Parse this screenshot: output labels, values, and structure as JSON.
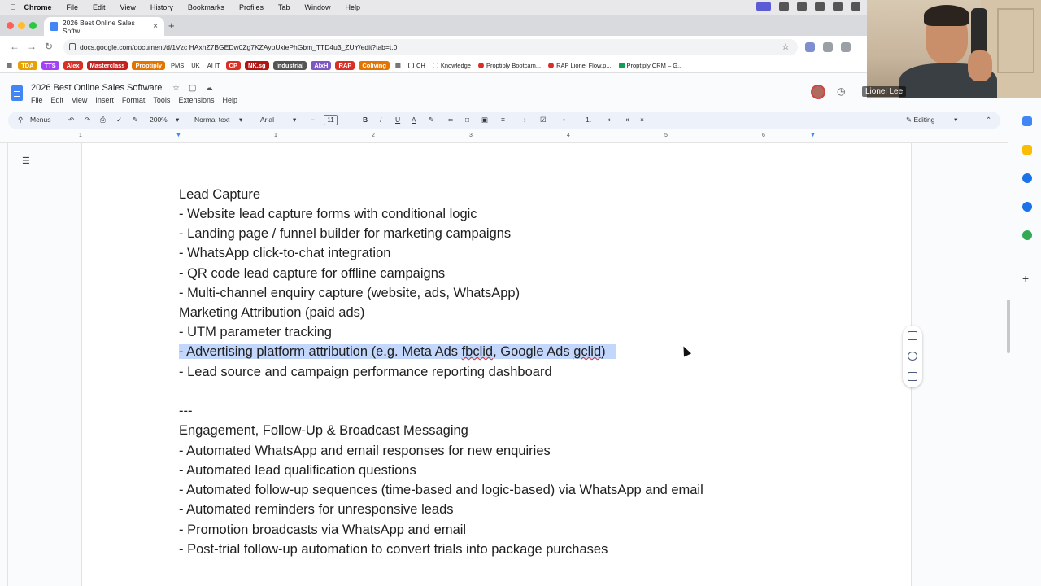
{
  "mac_menu": {
    "app": "Chrome",
    "items": [
      "File",
      "Edit",
      "View",
      "History",
      "Bookmarks",
      "Profiles",
      "Tab",
      "Window",
      "Help"
    ]
  },
  "browser": {
    "tab_title": "2026 Best Online Sales Softw",
    "url": "docs.google.com/document/d/1Vzc HAxhZ7BGEDw0Zg7KZAypUxiePhGbm_TTD4u3_ZUY/edit?tab=t.0",
    "bookmarks": [
      {
        "label": "TDA",
        "color": "#e8a100"
      },
      {
        "label": "TTS",
        "color": "#a142f4"
      },
      {
        "label": "Alex",
        "color": "#d93025"
      },
      {
        "label": "Masterclass",
        "color": "#c5221f"
      },
      {
        "label": "Proptiply",
        "color": "#e37400"
      },
      {
        "label": "PMS",
        "color": ""
      },
      {
        "label": "UK",
        "color": ""
      },
      {
        "label": "AI IT",
        "color": ""
      },
      {
        "label": "CP",
        "color": "#d93025"
      },
      {
        "label": "NK.sg",
        "color": "#b31412"
      },
      {
        "label": "Industrial",
        "color": "#555555"
      },
      {
        "label": "AIxH",
        "color": "#7e57c2"
      },
      {
        "label": "RAP",
        "color": "#d93025"
      },
      {
        "label": "Coliving",
        "color": "#e37400"
      },
      {
        "label": "CH",
        "color": ""
      },
      {
        "label": "Knowledge",
        "color": ""
      },
      {
        "label": "Proptiply Bootcam...",
        "color": ""
      },
      {
        "label": "RAP Lionel Flow.p...",
        "color": ""
      },
      {
        "label": "Proptiply CRM – G...",
        "color": ""
      }
    ]
  },
  "docs": {
    "title": "2026 Best Online Sales Software",
    "menus": [
      "File",
      "Edit",
      "View",
      "Insert",
      "Format",
      "Tools",
      "Extensions",
      "Help"
    ],
    "toolbar": {
      "menus_label": "Menus",
      "zoom": "200%",
      "style": "Normal text",
      "font": "Arial",
      "font_size": "11",
      "mode": "Editing"
    },
    "ruler_numbers": [
      "1",
      "1",
      "2",
      "3",
      "4",
      "5",
      "6"
    ]
  },
  "document": {
    "lines": [
      "Lead Capture",
      "- Website lead capture forms with conditional logic",
      "- Landing page / funnel builder for marketing campaigns",
      "- WhatsApp click-to-chat integration",
      "- QR code lead capture for offline campaigns",
      "- Multi-channel enquiry capture (website, ads, WhatsApp)",
      "Marketing Attribution (paid ads)",
      "- UTM parameter tracking",
      "",
      "- Lead source and campaign performance reporting dashboard",
      "",
      "---",
      "Engagement, Follow-Up & Broadcast Messaging",
      "- Automated WhatsApp and email responses for new enquiries",
      "- Automated lead qualification questions",
      "- Automated follow-up sequences (time-based and logic-based) via WhatsApp and email",
      "- Automated reminders for unresponsive leads",
      "- Promotion broadcasts via WhatsApp and email",
      "- Post-trial follow-up automation to convert trials into package purchases"
    ],
    "highlighted": {
      "part1": "- Advertising platform attribution (e.g. Meta Ads ",
      "part2": "fbclid",
      "part3": ", Google Ads ",
      "part4": "gclid",
      "part5": ")"
    }
  },
  "webcam": {
    "name": "Lionel Lee"
  }
}
